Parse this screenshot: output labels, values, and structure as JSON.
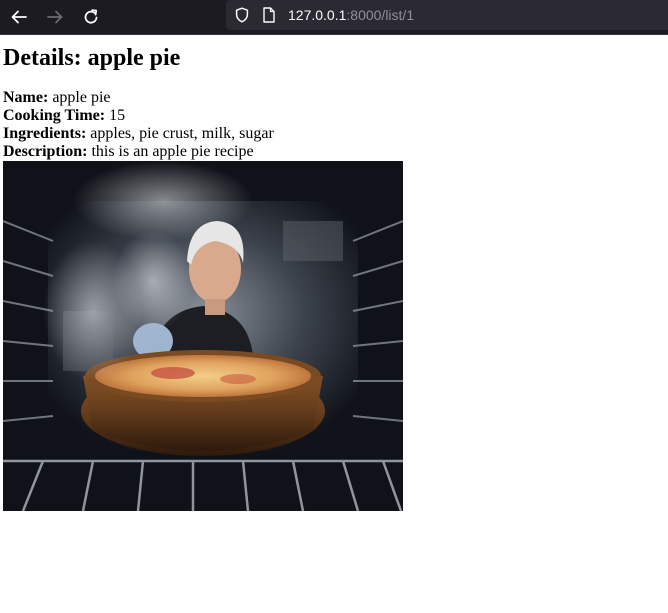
{
  "browser": {
    "url_host": "127.0.0.1",
    "url_path": ":8000/list/1",
    "icons": {
      "back": "arrow-left-icon",
      "forward": "arrow-right-icon",
      "reload": "reload-icon",
      "security": "shield-icon",
      "page": "page-icon"
    }
  },
  "page": {
    "heading": "Details: apple pie",
    "fields": [
      {
        "label": "Name:",
        "value": "apple pie"
      },
      {
        "label": "Cooking Time:",
        "value": "15"
      },
      {
        "label": "Ingredients:",
        "value": "apples, pie crust, milk, sugar"
      },
      {
        "label": "Description:",
        "value": "this is an apple pie recipe"
      }
    ]
  },
  "colors": {
    "chrome_bg": "#1c1b22",
    "urlbar_bg": "#2b2a33",
    "url_host": "#fbfbfe",
    "url_path": "#8f8f9d"
  }
}
